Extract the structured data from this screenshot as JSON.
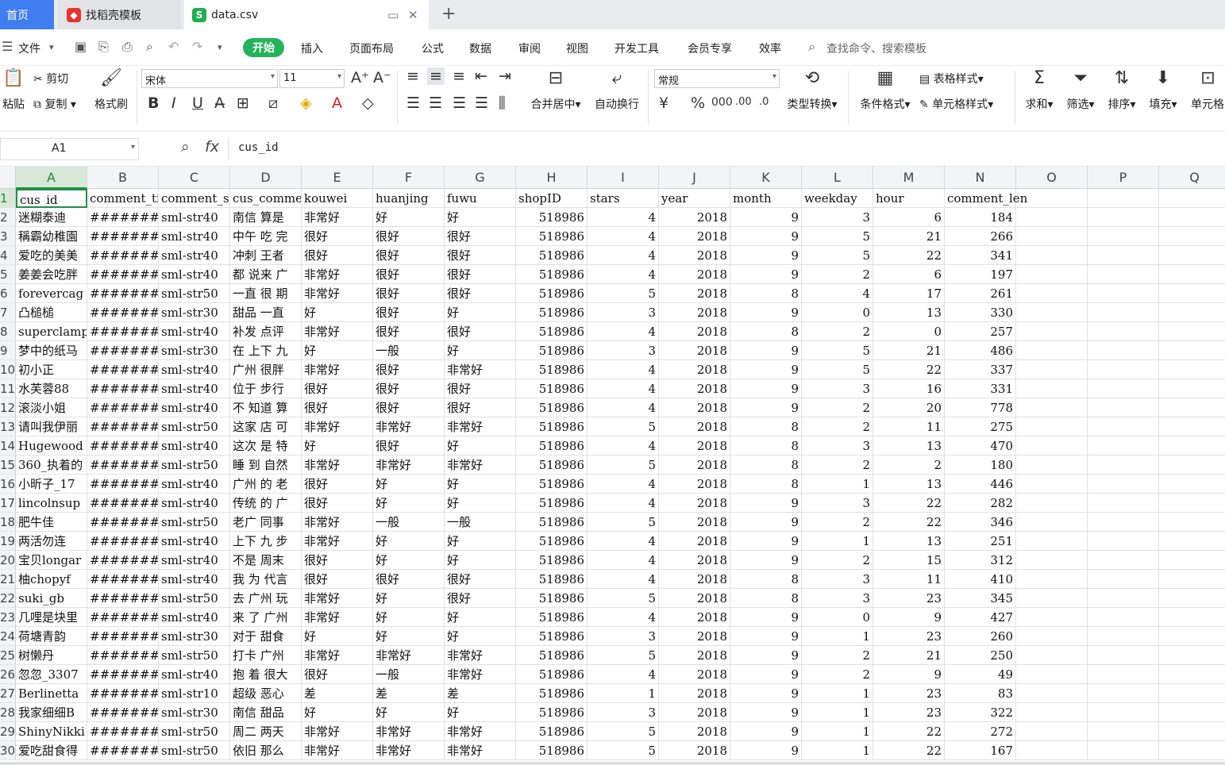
{
  "tabs": {
    "home": "首页",
    "template": "找稻壳模板",
    "file": "data.csv"
  },
  "menu": {
    "file": "文件",
    "items": [
      "开始",
      "插入",
      "页面布局",
      "公式",
      "数据",
      "审阅",
      "视图",
      "开发工具",
      "会员专享",
      "效率"
    ],
    "search": "查找命令、搜索模板"
  },
  "ribbon": {
    "paste": "粘贴",
    "cut": "剪切",
    "copy": "复制",
    "format_painter": "格式刷",
    "font": "宋体",
    "size": "11",
    "merge": "合并居中",
    "wrap": "自动换行",
    "number_format": "常规",
    "type_convert": "类型转换",
    "cond_format": "条件格式",
    "table_style": "表格样式",
    "cell_style": "单元格样式",
    "sum": "求和",
    "filter": "筛选",
    "sort": "排序",
    "fill": "填充",
    "cell": "单元格"
  },
  "formula_bar": {
    "cell_ref": "A1",
    "fx": "fx",
    "content": "cus_id"
  },
  "columns": [
    "A",
    "B",
    "C",
    "D",
    "E",
    "F",
    "G",
    "H",
    "I",
    "J",
    "K",
    "L",
    "M",
    "N",
    "O",
    "P",
    "Q"
  ],
  "header_row": [
    "cus_id",
    "comment_ti",
    "comment_st",
    "cus_commer",
    "kouwei",
    "huanjing",
    "fuwu",
    "shopID",
    "stars",
    "year",
    "month",
    "weekday",
    "hour",
    "comment_len"
  ],
  "row_numbers": [
    "1",
    "2",
    "3",
    "4",
    "5",
    "6",
    "7",
    "8",
    "9",
    "10",
    "11",
    "12",
    "13",
    "14",
    "15",
    "16",
    "17",
    "18",
    "19",
    "20",
    "21",
    "22",
    "23",
    "24",
    "25",
    "26",
    "27",
    "28",
    "29",
    "30"
  ],
  "rows": [
    [
      "迷糊泰迪",
      "#########",
      "sml-str40",
      "南信 算是",
      "非常好",
      "好",
      "好",
      "518986",
      "4",
      "2018",
      "9",
      "3",
      "6",
      "184"
    ],
    [
      "稱霸幼稚園",
      "#########",
      "sml-str40",
      "中午 吃 完",
      "很好",
      "很好",
      "很好",
      "518986",
      "4",
      "2018",
      "9",
      "5",
      "21",
      "266"
    ],
    [
      "爱吃的美美",
      "#########",
      "sml-str40",
      "冲刺 王者",
      "很好",
      "很好",
      "很好",
      "518986",
      "4",
      "2018",
      "9",
      "5",
      "22",
      "341"
    ],
    [
      "姜姜会吃胖",
      "#########",
      "sml-str40",
      "都 说来 广",
      "非常好",
      "很好",
      "很好",
      "518986",
      "4",
      "2018",
      "9",
      "2",
      "6",
      "197"
    ],
    [
      "forevercag",
      "#########",
      "sml-str50",
      "一直 很 期",
      "非常好",
      "很好",
      "很好",
      "518986",
      "5",
      "2018",
      "8",
      "4",
      "17",
      "261"
    ],
    [
      "凸槌槌",
      "#########",
      "sml-str30",
      "甜品 一直",
      "好",
      "很好",
      "好",
      "518986",
      "3",
      "2018",
      "9",
      "0",
      "13",
      "330"
    ],
    [
      "superclamp",
      "#########",
      "sml-str40",
      "补发 点评",
      "非常好",
      "很好",
      "很好",
      "518986",
      "4",
      "2018",
      "8",
      "2",
      "0",
      "257"
    ],
    [
      "梦中的纸马",
      "#########",
      "sml-str30",
      "在 上下 九",
      "好",
      "一般",
      "好",
      "518986",
      "3",
      "2018",
      "9",
      "5",
      "21",
      "486"
    ],
    [
      "初小正",
      "#########",
      "sml-str40",
      "广州 很胖",
      "非常好",
      "很好",
      "非常好",
      "518986",
      "4",
      "2018",
      "9",
      "5",
      "22",
      "337"
    ],
    [
      "水芙蓉88",
      "#########",
      "sml-str40",
      "位于 步行",
      "很好",
      "很好",
      "很好",
      "518986",
      "4",
      "2018",
      "9",
      "3",
      "16",
      "331"
    ],
    [
      "滚淡小姐",
      "#########",
      "sml-str40",
      "不 知道 算",
      "很好",
      "很好",
      "很好",
      "518986",
      "4",
      "2018",
      "9",
      "2",
      "20",
      "778"
    ],
    [
      "请叫我伊丽",
      "#########",
      "sml-str50",
      "这家 店 可",
      "非常好",
      "非常好",
      "非常好",
      "518986",
      "5",
      "2018",
      "8",
      "2",
      "11",
      "275"
    ],
    [
      "Hugewood",
      "#########",
      "sml-str40",
      "这次 是 特",
      "好",
      "很好",
      "好",
      "518986",
      "4",
      "2018",
      "8",
      "3",
      "13",
      "470"
    ],
    [
      "360_执着的",
      "#########",
      "sml-str50",
      "睡 到 自然",
      "非常好",
      "非常好",
      "非常好",
      "518986",
      "5",
      "2018",
      "8",
      "2",
      "2",
      "180"
    ],
    [
      "小昕子_17",
      "#########",
      "sml-str40",
      "广州 的 老",
      "很好",
      "好",
      "好",
      "518986",
      "4",
      "2018",
      "8",
      "1",
      "13",
      "446"
    ],
    [
      "lincolnsup",
      "#########",
      "sml-str40",
      "传统 的 广",
      "很好",
      "好",
      "好",
      "518986",
      "4",
      "2018",
      "9",
      "3",
      "22",
      "282"
    ],
    [
      "肥牛佳",
      "#########",
      "sml-str50",
      "老广 同事",
      "非常好",
      "一般",
      "一般",
      "518986",
      "5",
      "2018",
      "9",
      "2",
      "22",
      "346"
    ],
    [
      "两活勿连",
      "#########",
      "sml-str40",
      "上下 九 步",
      "非常好",
      "好",
      "好",
      "518986",
      "4",
      "2018",
      "9",
      "1",
      "13",
      "251"
    ],
    [
      "宝贝longar",
      "#########",
      "sml-str40",
      "不是 周末",
      "很好",
      "好",
      "好",
      "518986",
      "4",
      "2018",
      "9",
      "2",
      "15",
      "312"
    ],
    [
      "柚chopyf",
      "#########",
      "sml-str40",
      "我 为 代言",
      "很好",
      "很好",
      "很好",
      "518986",
      "4",
      "2018",
      "8",
      "3",
      "11",
      "410"
    ],
    [
      "suki_gb",
      "#########",
      "sml-str50",
      "去 广州 玩",
      "非常好",
      "好",
      "很好",
      "518986",
      "5",
      "2018",
      "8",
      "3",
      "23",
      "345"
    ],
    [
      "几哩是块里",
      "#########",
      "sml-str40",
      "来 了 广州",
      "非常好",
      "好",
      "好",
      "518986",
      "4",
      "2018",
      "9",
      "0",
      "9",
      "427"
    ],
    [
      "荷塘青韵",
      "#########",
      "sml-str30",
      "对于 甜食",
      "好",
      "好",
      "好",
      "518986",
      "3",
      "2018",
      "9",
      "1",
      "23",
      "260"
    ],
    [
      "树懒丹",
      "#########",
      "sml-str50",
      "打卡 广州",
      "非常好",
      "非常好",
      "非常好",
      "518986",
      "5",
      "2018",
      "9",
      "2",
      "21",
      "250"
    ],
    [
      "忽忽_3307",
      "#########",
      "sml-str40",
      "抱 着 很大",
      "很好",
      "一般",
      "非常好",
      "518986",
      "4",
      "2018",
      "9",
      "2",
      "9",
      "49"
    ],
    [
      "Berlinetta",
      "#########",
      "sml-str10",
      "超级 恶心",
      "差",
      "差",
      "差",
      "518986",
      "1",
      "2018",
      "9",
      "1",
      "23",
      "83"
    ],
    [
      "我家细细B",
      "#########",
      "sml-str30",
      "南信 甜品",
      "好",
      "好",
      "好",
      "518986",
      "3",
      "2018",
      "9",
      "1",
      "23",
      "322"
    ],
    [
      "ShinyNikki",
      "#########",
      "sml-str50",
      "周二 两天",
      "非常好",
      "非常好",
      "非常好",
      "518986",
      "5",
      "2018",
      "9",
      "1",
      "22",
      "272"
    ],
    [
      "爱吃甜食得",
      "#########",
      "sml-str50",
      "依旧 那么",
      "非常好",
      "非常好",
      "非常好",
      "518986",
      "5",
      "2018",
      "9",
      "1",
      "22",
      "167"
    ]
  ],
  "colors": {
    "accent": "#25b35a",
    "selection": "#1f8f45",
    "home_tab": "#3f7ef0"
  }
}
